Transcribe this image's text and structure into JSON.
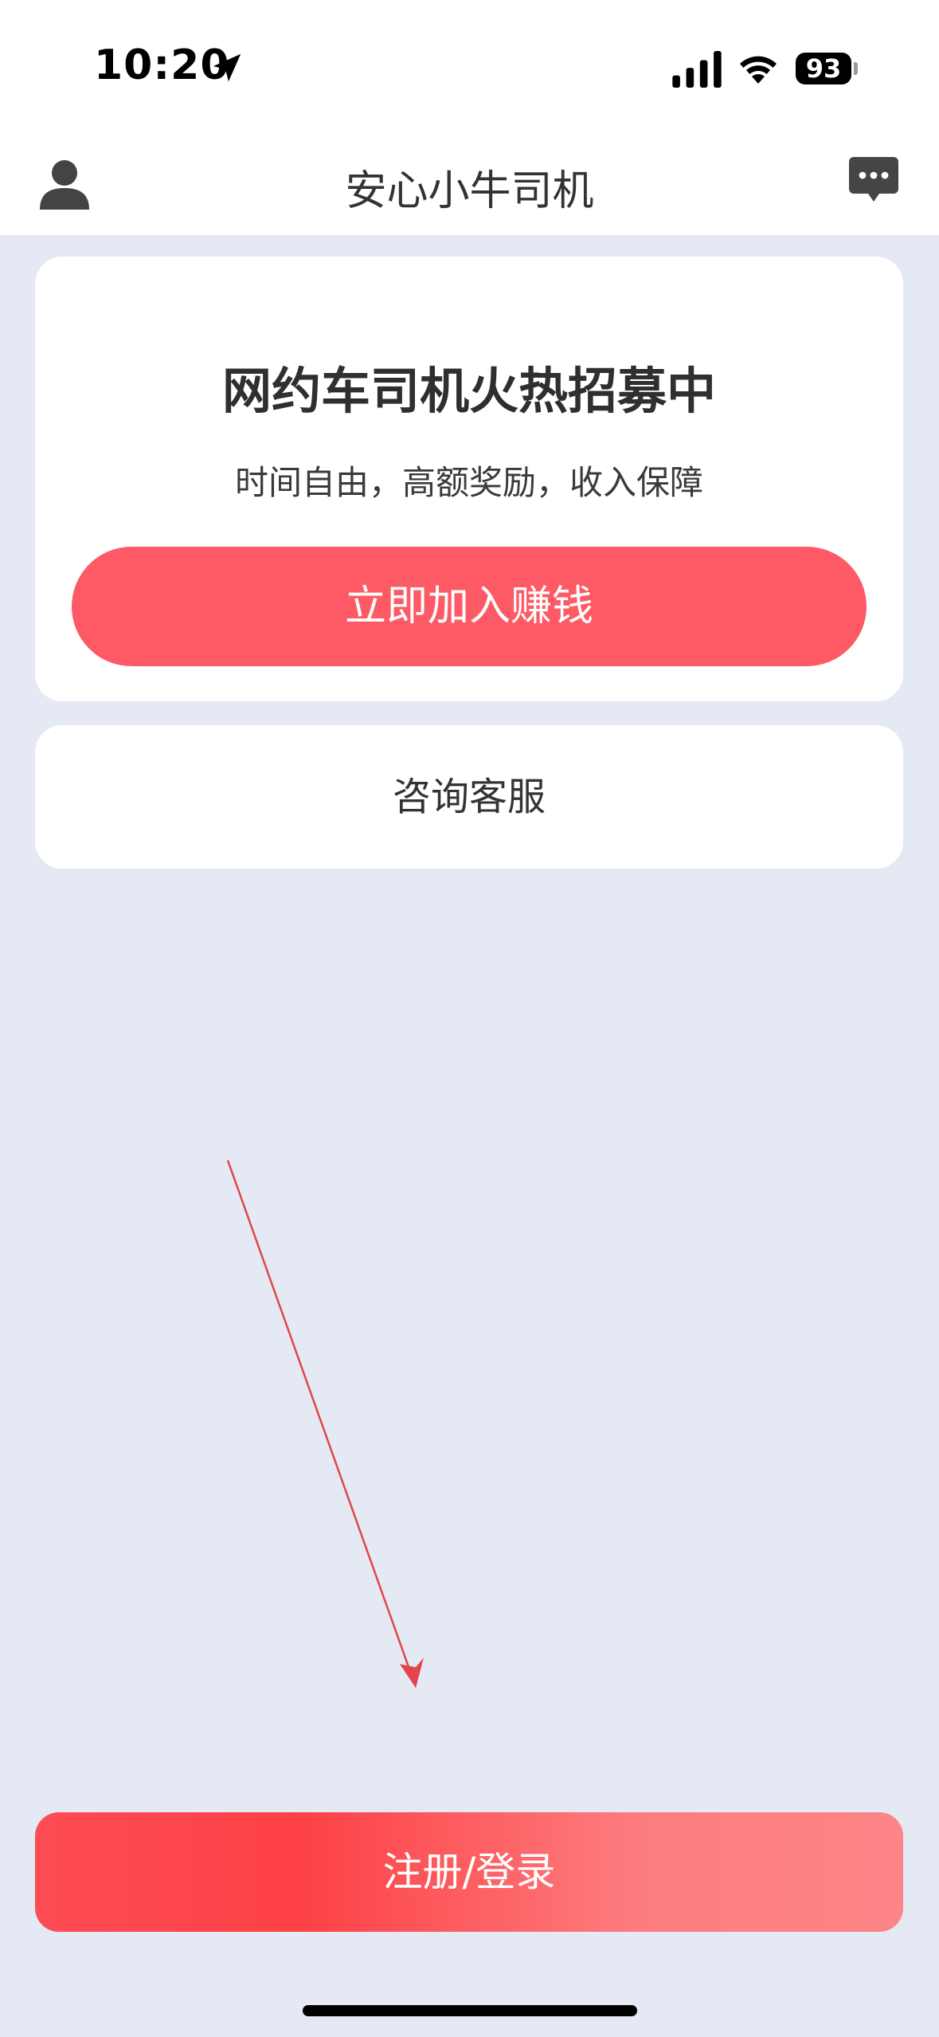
{
  "status_bar": {
    "time": "10:20",
    "battery": "93",
    "icons": [
      "location-arrow-icon",
      "cellular-signal-icon",
      "wifi-icon",
      "battery-icon"
    ]
  },
  "nav": {
    "title": "安心小牛司机",
    "left_icon": "user-icon",
    "right_icon": "message-icon"
  },
  "recruit_card": {
    "title": "网约车司机火热招募中",
    "subtitle": "时间自由，高额奖励，收入保障",
    "join_button": "立即加入赚钱"
  },
  "service_card": {
    "label": "咨询客服"
  },
  "login_button": {
    "label": "注册/登录"
  },
  "colors": {
    "page_background": "#e4e9f3",
    "primary_red": "#fd5a66",
    "login_gradient_start": "#fd4045",
    "login_gradient_end": "#fd8587",
    "arrow_annotation": "#e0464a"
  }
}
